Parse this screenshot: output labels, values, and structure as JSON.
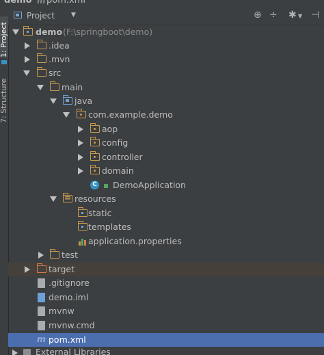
{
  "window": {
    "breadcrumb": [
      "demo",
      "pom.xml"
    ]
  },
  "tool_strip": {
    "project_tab": "1: Project",
    "structure_tab": "7: Structure"
  },
  "panel": {
    "title": "Project",
    "icons": [
      "locate-icon",
      "collapse-icon",
      "gear-icon",
      "hide-icon"
    ]
  },
  "tree": {
    "root": {
      "label": "demo",
      "path": "(F:\\springboot\\demo)"
    },
    "items": [
      {
        "label": ".idea"
      },
      {
        "label": ".mvn"
      },
      {
        "label": "src"
      },
      {
        "label": "main"
      },
      {
        "label": "java"
      },
      {
        "label": "com.example.demo"
      },
      {
        "label": "aop"
      },
      {
        "label": "config"
      },
      {
        "label": "controller"
      },
      {
        "label": "domain"
      },
      {
        "label": "DemoApplication"
      },
      {
        "label": "resources"
      },
      {
        "label": "static"
      },
      {
        "label": "templates"
      },
      {
        "label": "application.properties"
      },
      {
        "label": "test"
      },
      {
        "label": "target"
      },
      {
        "label": ".gitignore"
      },
      {
        "label": "demo.iml"
      },
      {
        "label": "mvnw"
      },
      {
        "label": "mvnw.cmd"
      },
      {
        "label": "pom.xml"
      },
      {
        "label": "External Libraries"
      }
    ]
  },
  "colors": {
    "background": "#3c3f41",
    "selection": "#4b6eaf",
    "excluded_row": "#45403a",
    "folder": "#c69a4e",
    "source_folder": "#6ea0d8",
    "excluded_folder": "#d87a4a"
  }
}
